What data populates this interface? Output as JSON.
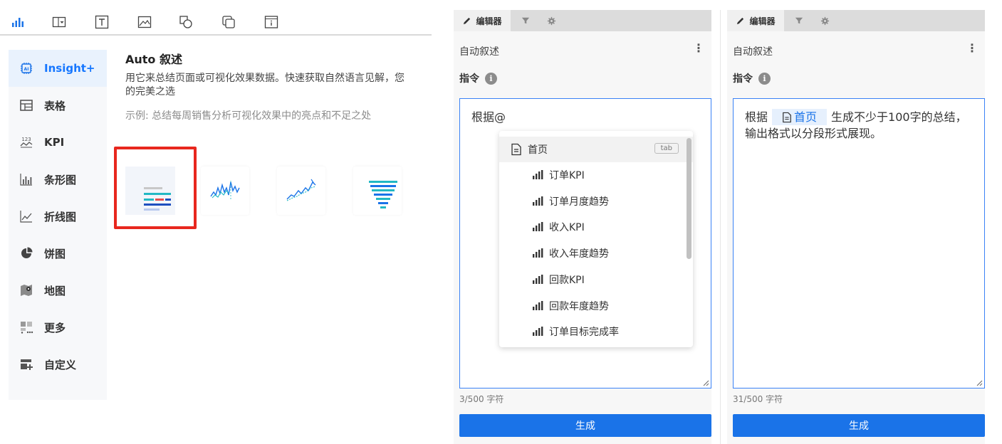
{
  "toolbar": {
    "icons": [
      "bar-chart-icon",
      "dropdown-box-icon",
      "text-box-icon",
      "image-icon",
      "shapes-icon",
      "duplicate-icon",
      "info-card-icon"
    ]
  },
  "sidebar": {
    "items": [
      {
        "label": "Insight+",
        "icon": "ai-chip-icon",
        "active": true
      },
      {
        "label": "表格",
        "icon": "table-icon"
      },
      {
        "label": "KPI",
        "icon": "kpi-icon"
      },
      {
        "label": "条形图",
        "icon": "bar-chart-icon"
      },
      {
        "label": "折线图",
        "icon": "line-chart-icon"
      },
      {
        "label": "饼图",
        "icon": "pie-chart-icon"
      },
      {
        "label": "地图",
        "icon": "map-icon"
      },
      {
        "label": "更多",
        "icon": "more-grid-icon"
      },
      {
        "label": "自定义",
        "icon": "custom-add-icon"
      }
    ]
  },
  "content": {
    "title": "Auto 叙述",
    "description": "用它来总结页面或可视化效果数据。快速获取自然语言见解，您的完美之选",
    "example": "示例: 总结每周销售分析可视化效果中的亮点和不足之处"
  },
  "colors": {
    "accent": "#1a73e8",
    "active_bg": "#e9f2fd",
    "selected_border": "#e8271e"
  },
  "editor_left": {
    "tab_label": "编辑器",
    "title": "自动叙述",
    "more": "⋮",
    "instruction_label": "指令",
    "info": "i",
    "input_text": "根据@",
    "char_count": "3/500 字符",
    "generate_label": "生成",
    "dropdown": {
      "head": "首页",
      "tab_hint": "tab",
      "items": [
        "订单KPI",
        "订单月度趋势",
        "收入KPI",
        "收入年度趋势",
        "回款KPI",
        "回款年度趋势",
        "订单目标完成率"
      ]
    }
  },
  "editor_right": {
    "tab_label": "编辑器",
    "title": "自动叙述",
    "more": "⋮",
    "instruction_label": "指令",
    "info": "i",
    "text_before": "根据",
    "mention": "首页",
    "text_after": "生成不少于100字的总结，输出格式以分段形式展现。",
    "char_count": "31/500 字符",
    "generate_label": "生成"
  }
}
